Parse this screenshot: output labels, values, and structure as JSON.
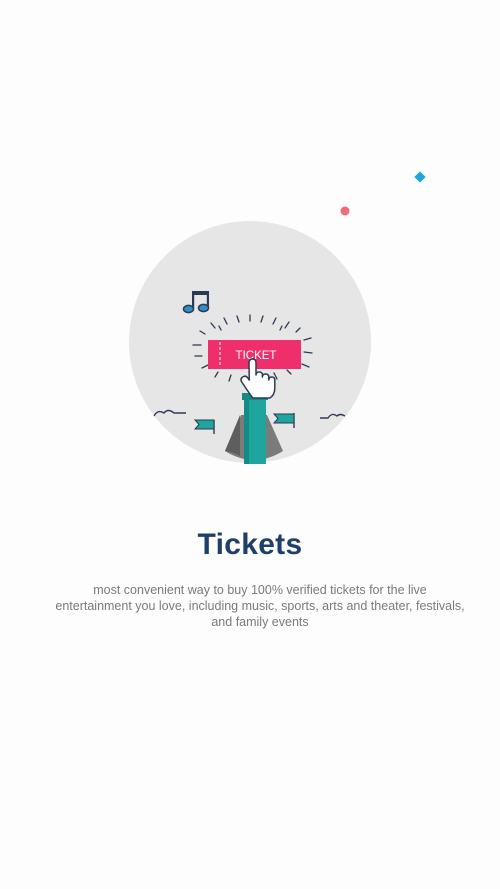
{
  "onboarding": {
    "title": "Tickets",
    "description": "most convenient way to buy 100% verified tickets for the live entertainment you love, including music, sports, arts and theater, festivals, and family events",
    "ticket_label": "TICKET"
  },
  "colors": {
    "circle_bg": "#e6e6e6",
    "ticket_pink": "#ef2f6b",
    "teal": "#1ea59e",
    "title_blue": "#1f3f6b",
    "navy": "#2b3b55"
  }
}
